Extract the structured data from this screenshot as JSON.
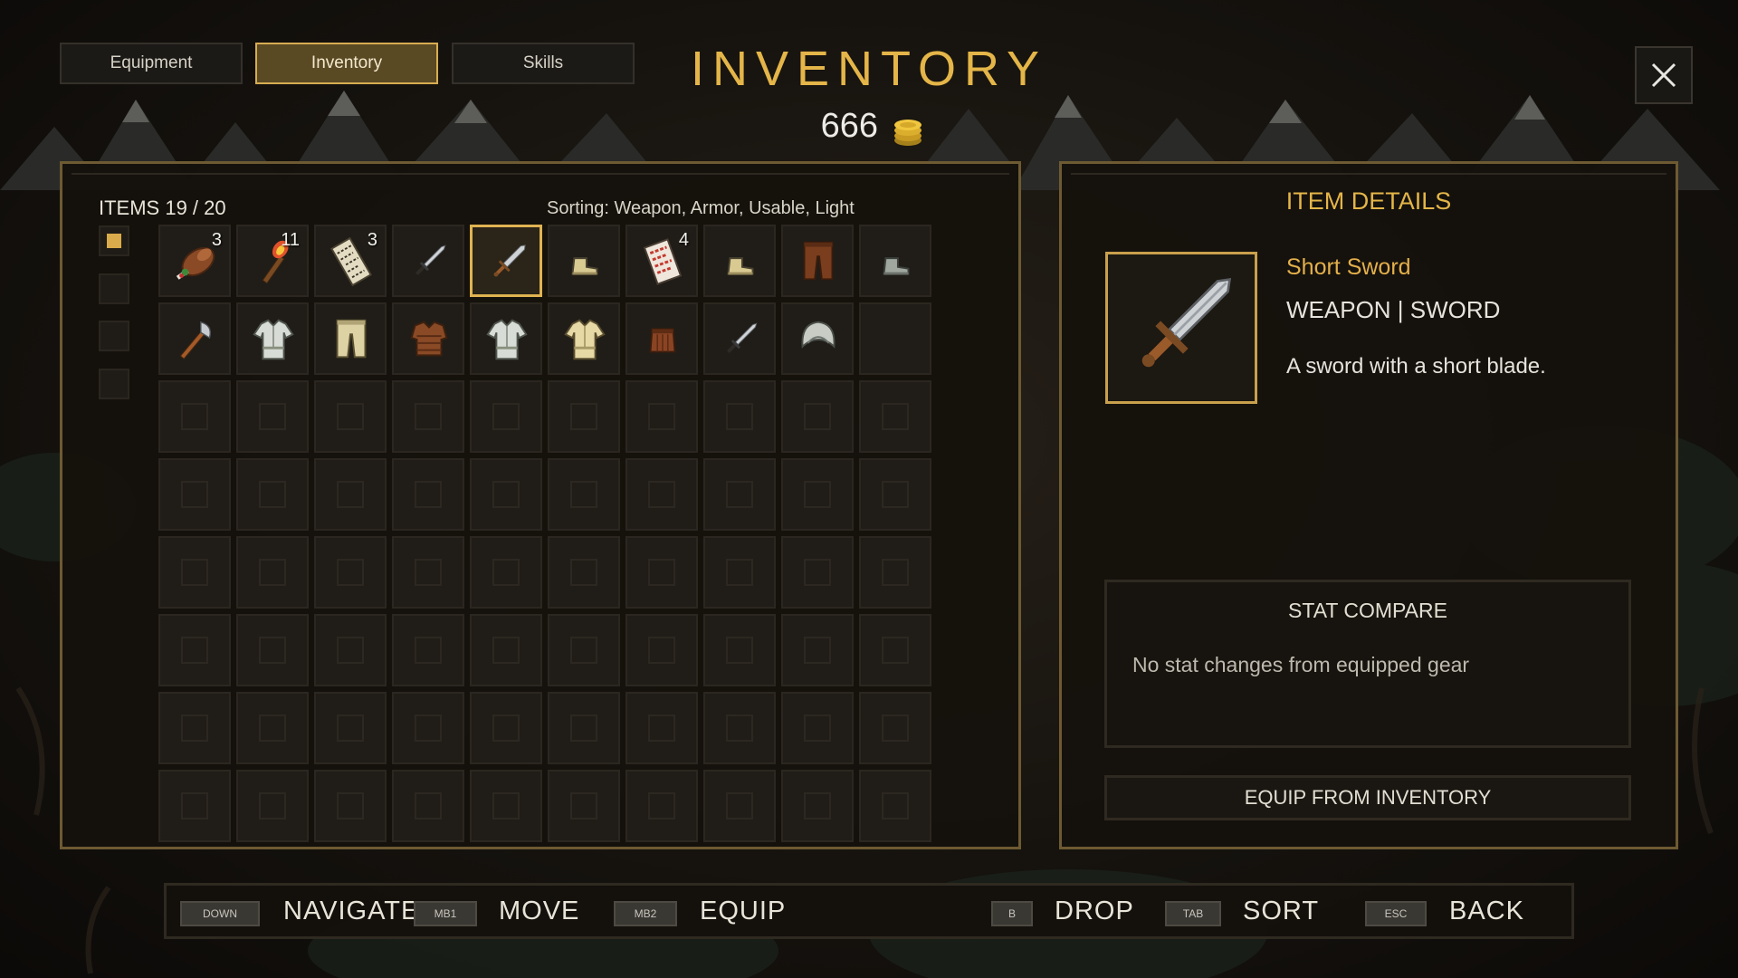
{
  "tabs": [
    {
      "label": "Equipment",
      "active": false
    },
    {
      "label": "Inventory",
      "active": true
    },
    {
      "label": "Skills",
      "active": false
    }
  ],
  "title": "INVENTORY",
  "gold": "666",
  "inventory": {
    "items_count": "ITEMS 19 / 20",
    "sorting": "Sorting: Weapon, Armor, Usable, Light",
    "filters": [
      true,
      false,
      false,
      false
    ],
    "slots": [
      {
        "icon": "meat-icon",
        "count": "3"
      },
      {
        "icon": "torch-icon",
        "count": "11"
      },
      {
        "icon": "map-scroll-icon",
        "count": "3"
      },
      {
        "icon": "dagger-icon",
        "count": ""
      },
      {
        "icon": "short-sword-icon",
        "count": "",
        "selected": true
      },
      {
        "icon": "cloth-boots-icon",
        "count": ""
      },
      {
        "icon": "red-scroll-icon",
        "count": "4"
      },
      {
        "icon": "cloth-boots-icon",
        "count": ""
      },
      {
        "icon": "leather-pants-icon",
        "count": ""
      },
      {
        "icon": "grey-boots-icon",
        "count": ""
      },
      {
        "icon": "axe-icon",
        "count": ""
      },
      {
        "icon": "cloth-shirt-icon",
        "count": ""
      },
      {
        "icon": "cloth-pants-icon",
        "count": ""
      },
      {
        "icon": "leather-armor-icon",
        "count": ""
      },
      {
        "icon": "cloth-shirt-icon",
        "count": ""
      },
      {
        "icon": "tan-shirt-icon",
        "count": ""
      },
      {
        "icon": "leather-skirt-icon",
        "count": ""
      },
      {
        "icon": "dagger-icon",
        "count": ""
      },
      {
        "icon": "hood-icon",
        "count": ""
      },
      {
        "icon": "",
        "count": "",
        "filled_empty": true
      }
    ],
    "empty_slot_count": 60
  },
  "details": {
    "heading": "ITEM DETAILS",
    "icon": "short-sword-icon",
    "name": "Short Sword",
    "type": "WEAPON | SWORD",
    "description": "A sword with a short blade.",
    "stat_compare_title": "STAT COMPARE",
    "stat_compare_text": "No stat changes from equipped gear",
    "equip_button": "EQUIP FROM INVENTORY"
  },
  "hints": [
    {
      "key": "DOWN",
      "label": "NAVIGATE"
    },
    {
      "key": "MB1",
      "label": "MOVE"
    },
    {
      "key": "MB2",
      "label": "EQUIP"
    },
    {
      "key": "B",
      "label": "DROP"
    },
    {
      "key": "TAB",
      "label": "SORT"
    },
    {
      "key": "ESC",
      "label": "BACK"
    }
  ],
  "colors": {
    "accent_gold": "#e4b548",
    "selected_border": "#e0b352",
    "panel_border": "#6e5a32"
  }
}
